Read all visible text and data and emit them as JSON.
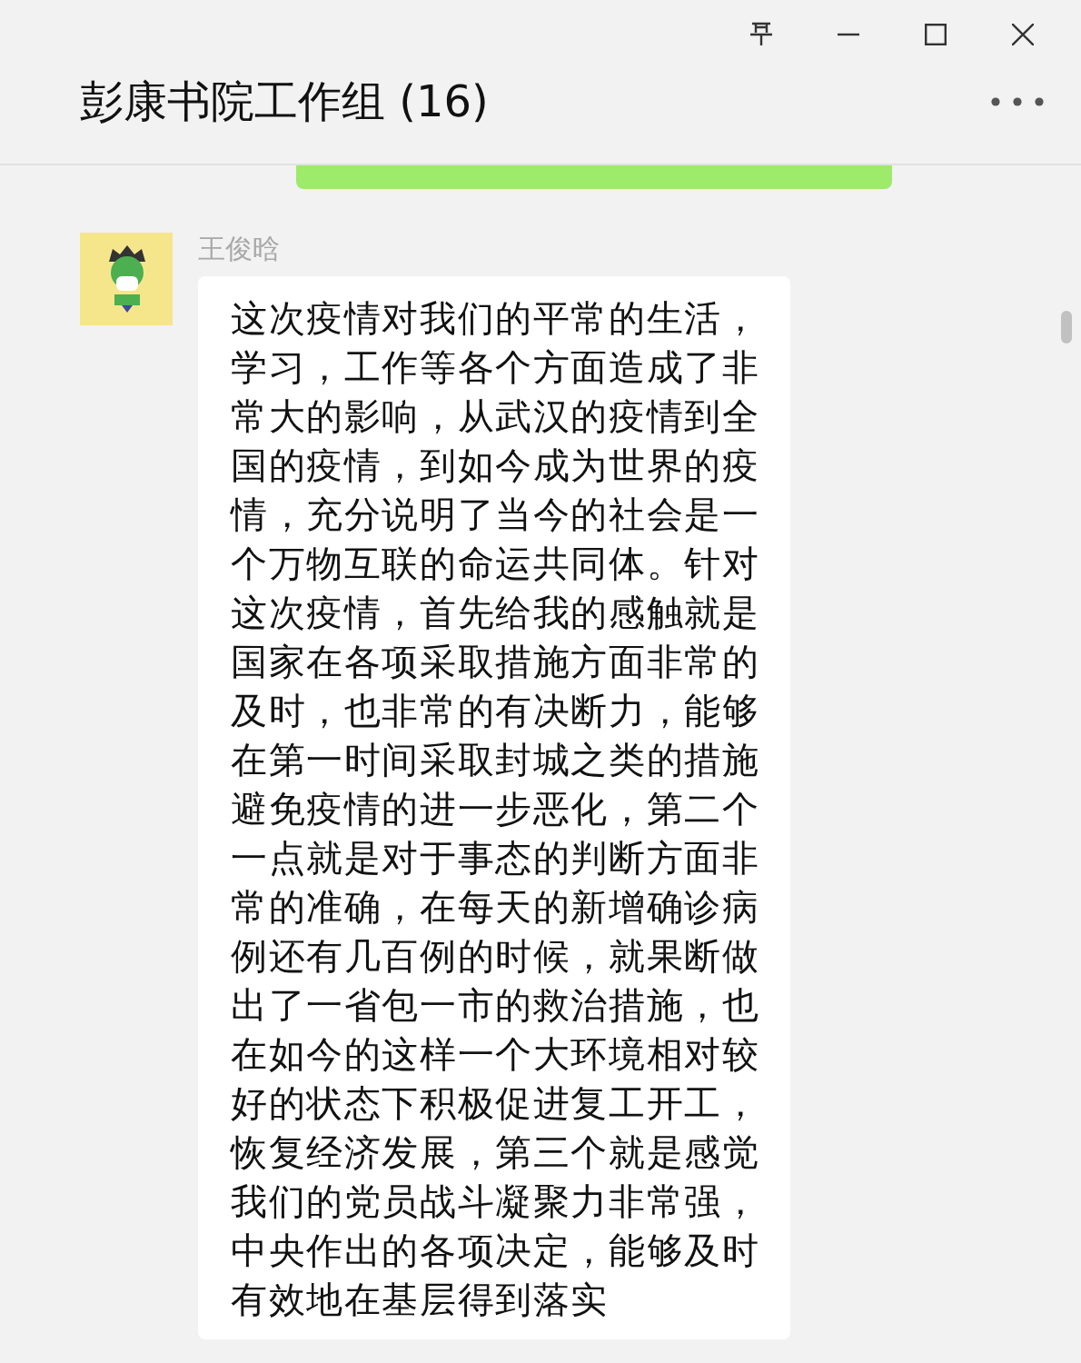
{
  "window": {
    "title": "彭康书院工作组 (16)"
  },
  "messages": [
    {
      "sender": "王俊晗",
      "text": "这次疫情对我们的平常的生活，学习，工作等各个方面造成了非常大的影响，从武汉的疫情到全国的疫情，到如今成为世界的疫情，充分说明了当今的社会是一个万物互联的命运共同体。针对这次疫情，首先给我的感触就是国家在各项采取措施方面非常的及时，也非常的有决断力，能够在第一时间采取封城之类的措施避免疫情的进一步恶化，第二个一点就是对于事态的判断方面非常的准确，在每天的新增确诊病例还有几百例的时候，就果断做出了一省包一市的救治措施，也在如今的这样一个大环境相对较好的状态下积极促进复工开工，恢复经济发展，第三个就是感觉我们的党员战斗凝聚力非常强，中央作出的各项决定，能够及时有效地在基层得到落实"
    }
  ]
}
